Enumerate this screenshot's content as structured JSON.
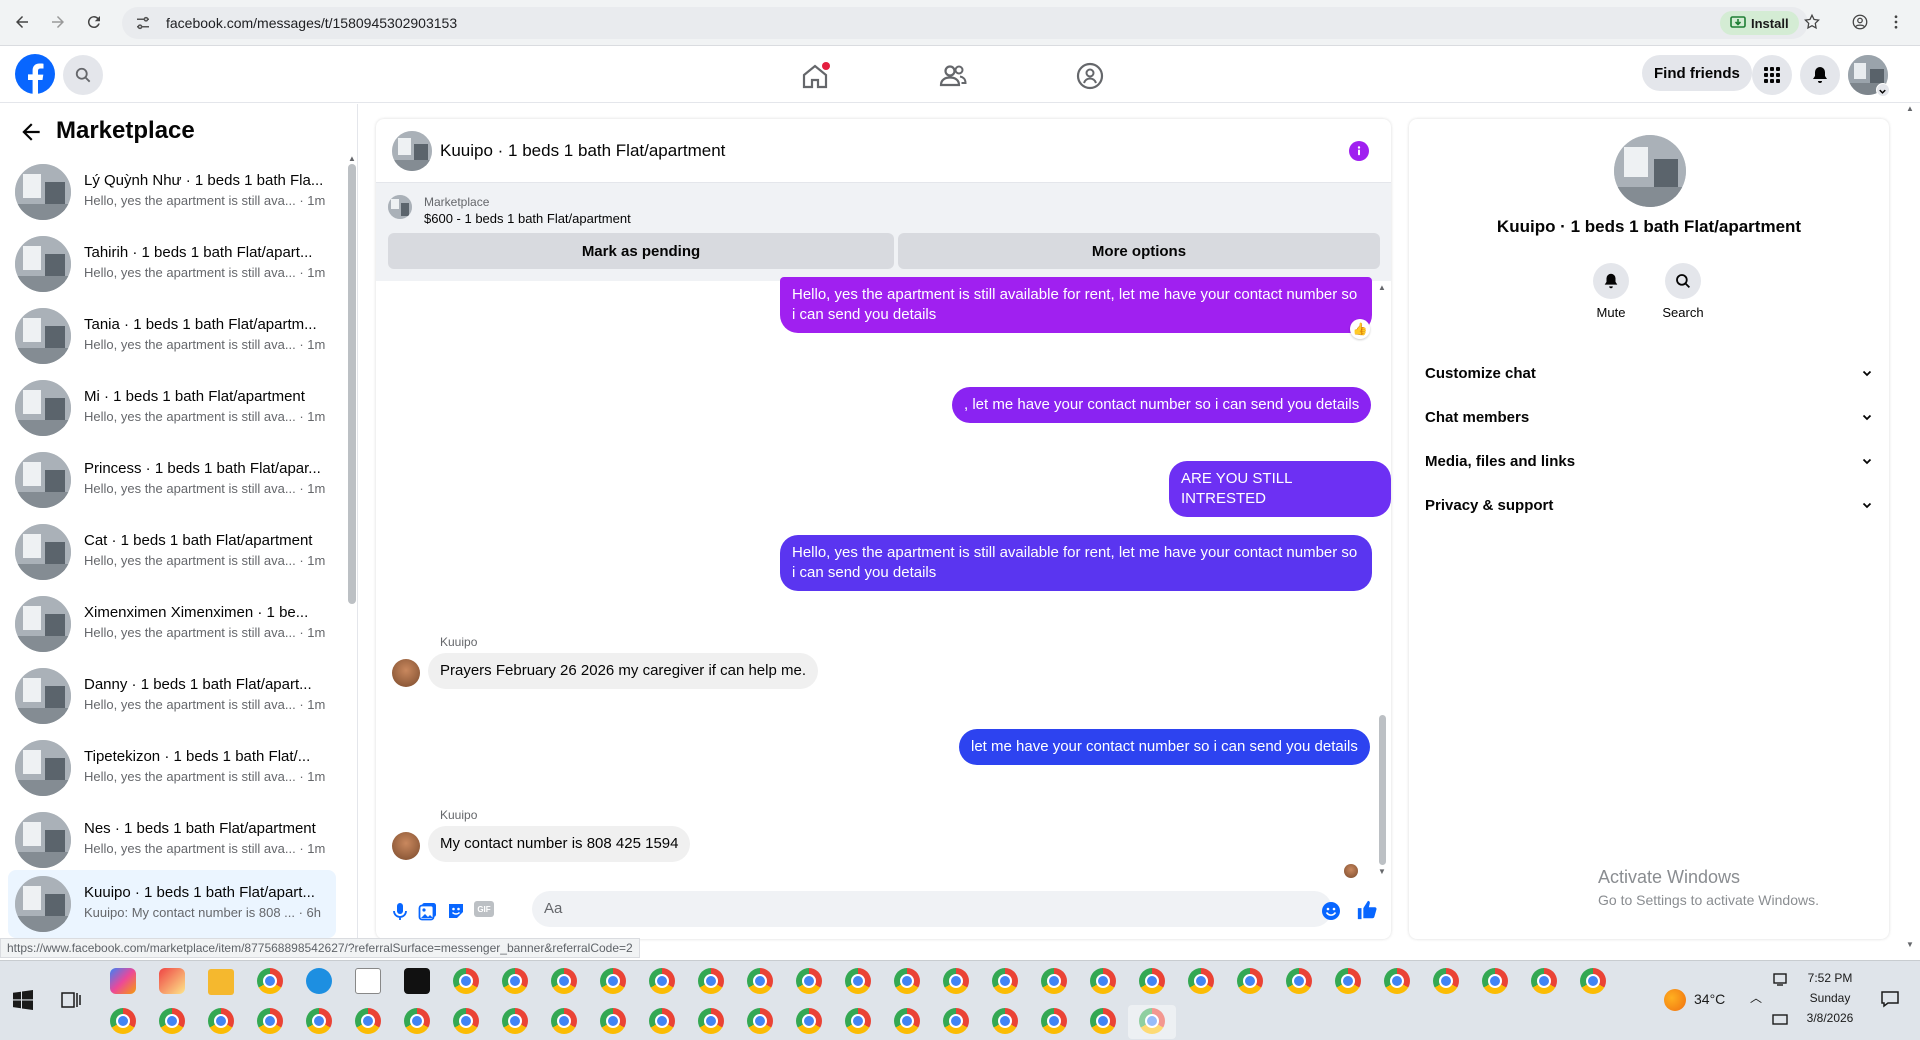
{
  "browser": {
    "url": "facebook.com/messages/t/1580945302903153",
    "install_label": "Install"
  },
  "header": {
    "find_friends": "Find friends"
  },
  "sidebar": {
    "title": "Marketplace",
    "conversations": [
      {
        "name": "Lý Quỳnh Như · 1 beds 1 bath Fla...",
        "preview": "Hello, yes the apartment is still ava... · 1m"
      },
      {
        "name": "Tahirih · 1 beds 1 bath Flat/apart...",
        "preview": "Hello, yes the apartment is still ava... · 1m"
      },
      {
        "name": "Tania · 1 beds 1 bath Flat/apartm...",
        "preview": "Hello, yes the apartment is still ava... · 1m"
      },
      {
        "name": "Mi · 1 beds 1 bath Flat/apartment",
        "preview": "Hello, yes the apartment is still ava... · 1m"
      },
      {
        "name": "Princess · 1 beds 1 bath Flat/apar...",
        "preview": "Hello, yes the apartment is still ava... · 1m"
      },
      {
        "name": "Cat · 1 beds 1 bath Flat/apartment",
        "preview": "Hello, yes the apartment is still ava... · 1m"
      },
      {
        "name": "Ximenximen Ximenximen · 1 be...",
        "preview": "Hello, yes the apartment is still ava... · 1m"
      },
      {
        "name": "Danny · 1 beds 1 bath Flat/apart...",
        "preview": "Hello, yes the apartment is still ava... · 1m"
      },
      {
        "name": "Tipetekizon · 1 beds 1 bath Flat/...",
        "preview": "Hello, yes the apartment is still ava... · 1m"
      },
      {
        "name": "Nes · 1 beds 1 bath Flat/apartment",
        "preview": "Hello, yes the apartment is still ava... · 1m"
      },
      {
        "name": "Kuuipo · 1 beds 1 bath Flat/apart...",
        "preview": "Kuuipo: My contact number is 808 ... · 6h"
      }
    ]
  },
  "chat": {
    "title": "Kuuipo · 1 beds 1 bath Flat/apartment",
    "banner_source": "Marketplace",
    "banner_listing": "$600 - 1 beds 1 bath Flat/apartment",
    "mark_pending": "Mark as pending",
    "more_options": "More options",
    "messages": [
      {
        "line1": "Hello, yes the apartment is still available for rent, let me have your contact number so",
        "line2": "i can send you details"
      },
      {
        "text": ", let me have your contact number so i can send you details"
      },
      {
        "text": "ARE YOU STILL INTRESTED"
      },
      {
        "line1": "Hello, yes the apartment is still available for rent, let me have your contact number so",
        "line2": "i can send you details"
      },
      {
        "sender": "Kuuipo",
        "text": "Prayers February 26 2026 my caregiver if can help me."
      },
      {
        "text": "let me have your contact number so i can send you details"
      },
      {
        "sender": "Kuuipo",
        "text": "My contact number is 808 425 1594"
      }
    ],
    "input_placeholder": "Aa"
  },
  "right_panel": {
    "name": "Kuuipo · 1 beds 1 bath Flat/apartment",
    "mute": "Mute",
    "search": "Search",
    "sections": [
      "Customize chat",
      "Chat members",
      "Media, files and links",
      "Privacy & support"
    ],
    "activate_title": "Activate Windows",
    "activate_sub": "Go to Settings to activate Windows."
  },
  "status_url": "https://www.facebook.com/marketplace/item/877568898542627/?referralSurface=messenger_banner&referralCode=2",
  "taskbar": {
    "weather": "34°C",
    "time": "7:52 PM",
    "day": "Sunday",
    "date": "3/8/2026"
  },
  "colors": {
    "fb_blue": "#0866ff",
    "bubble_purple": "#a020f0",
    "bubble_violet": "#7b2cf5",
    "bubble_blue": "#2d43f0"
  }
}
